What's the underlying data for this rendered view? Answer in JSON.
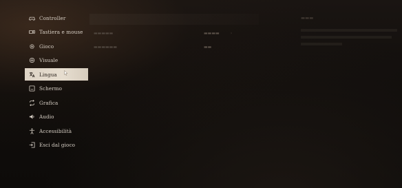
{
  "menu": {
    "items": [
      {
        "label": "Controller",
        "icon": "gamepad-icon"
      },
      {
        "label": "Tastiera e mouse",
        "icon": "keyboard-mouse-icon"
      },
      {
        "label": "Gioco",
        "icon": "gear-icon"
      },
      {
        "label": "Visuale",
        "icon": "camera-icon"
      },
      {
        "label": "Lingua",
        "icon": "language-icon"
      },
      {
        "label": "Schermo",
        "icon": "monitor-icon"
      },
      {
        "label": "Grafica",
        "icon": "graphics-icon"
      },
      {
        "label": "Audio",
        "icon": "speaker-icon"
      },
      {
        "label": "Accessibilità",
        "icon": "accessibility-icon"
      },
      {
        "label": "Esci dal gioco",
        "icon": "exit-icon"
      }
    ],
    "active_index": 4
  },
  "colors": {
    "active_bg": "#e2d8ca",
    "active_text": "#2a221c",
    "menu_text": "#d8d0c6",
    "background": "#100d0b"
  }
}
